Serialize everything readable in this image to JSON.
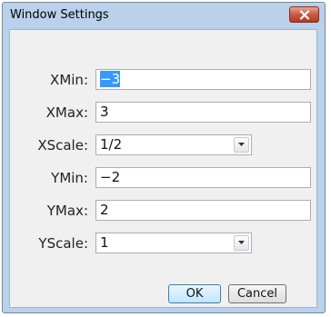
{
  "window": {
    "title": "Window Settings",
    "close_icon": "close-x-icon"
  },
  "fields": [
    {
      "label": "XMin:",
      "value": "−3",
      "type": "text",
      "selected": true
    },
    {
      "label": "XMax:",
      "value": "3",
      "type": "text"
    },
    {
      "label": "XScale:",
      "value": "1/2",
      "type": "dropdown"
    },
    {
      "label": "YMin:",
      "value": "−2",
      "type": "text"
    },
    {
      "label": "YMax:",
      "value": "2",
      "type": "text"
    },
    {
      "label": "YScale:",
      "value": "1",
      "type": "dropdown"
    }
  ],
  "buttons": {
    "ok": "OK",
    "cancel": "Cancel"
  },
  "colors": {
    "title_bar": "#b9d1ea",
    "close_button": "#c75b43",
    "selection": "#3399ff",
    "dialog_body": "#f0f0f0"
  }
}
